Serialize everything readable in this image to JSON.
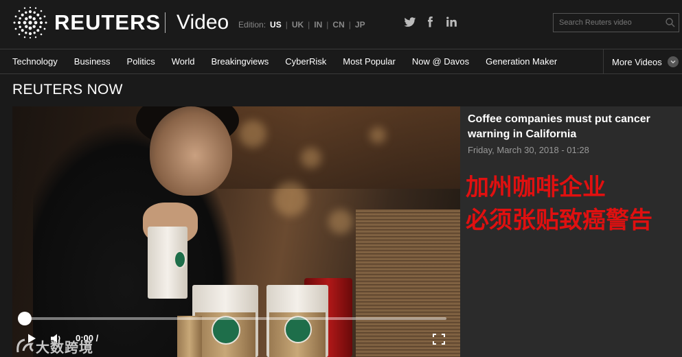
{
  "header": {
    "brand": "REUTERS",
    "section": "Video",
    "edition_label": "Edition:",
    "editions": [
      {
        "code": "US",
        "active": true
      },
      {
        "code": "UK",
        "active": false
      },
      {
        "code": "IN",
        "active": false
      },
      {
        "code": "CN",
        "active": false
      },
      {
        "code": "JP",
        "active": false
      }
    ],
    "social_icons": [
      "twitter-icon",
      "facebook-icon",
      "linkedin-icon"
    ],
    "search_placeholder": "Search Reuters video"
  },
  "nav": {
    "items": [
      "Technology",
      "Business",
      "Politics",
      "World",
      "Breakingviews",
      "CyberRisk",
      "Most Popular",
      "Now @ Davos",
      "Generation Maker"
    ],
    "more_label": "More Videos"
  },
  "section_title": "REUTERS NOW",
  "player": {
    "time": "0:00 /",
    "progress": 0.0,
    "watermark": "大数跨境"
  },
  "story": {
    "title": "Coffee companies must put cancer warning in California",
    "date": "Friday, March 30, 2018 - 01:28",
    "overlay_line1": "加州咖啡企业",
    "overlay_line2": "必须张贴致癌警告"
  },
  "colors": {
    "background": "#1a1a1a",
    "panel": "#2b2b2b",
    "overlay_red": "#e01010"
  }
}
